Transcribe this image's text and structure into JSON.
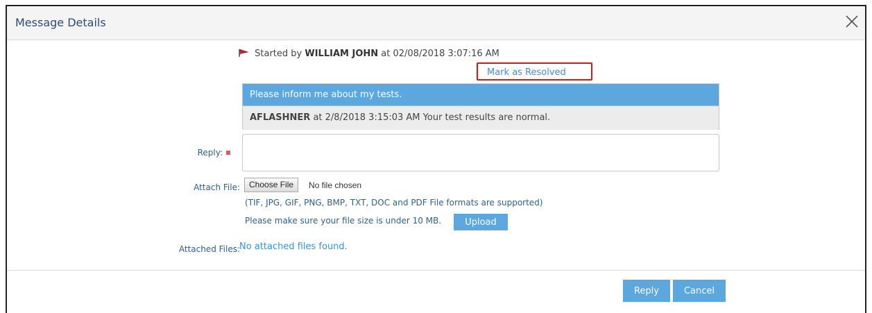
{
  "dialog": {
    "title": "Message Details"
  },
  "thread": {
    "started_prefix": "Started by",
    "author": "WILLIAM JOHN",
    "started_at": "at 02/08/2018 3:07:16 AM",
    "mark_resolved": "Mark as Resolved",
    "subject": "Please inform me about my tests.",
    "reply_author": "AFLASHNER",
    "reply_text": "at 2/8/2018 3:15:03 AM Your test results are normal."
  },
  "form": {
    "reply_label": "Reply:",
    "attach_label": "Attach File:",
    "choose_file": "Choose File",
    "no_file": "No file chosen",
    "formats_note": "(TIF, JPG, GIF, PNG, BMP, TXT, DOC and PDF File formats are supported)",
    "size_note": "Please make sure your file size is under 10 MB.",
    "upload": "Upload",
    "attached_label": "Attached Files:",
    "no_attached": "No attached files found."
  },
  "footer": {
    "reply": "Reply",
    "cancel": "Cancel"
  },
  "colors": {
    "accent": "#5ba7de",
    "title": "#2a4d74",
    "label": "#2f5f8e",
    "link": "#3f8fd6",
    "required": "#e45a5a",
    "highlight_box": "#b02a2a"
  }
}
